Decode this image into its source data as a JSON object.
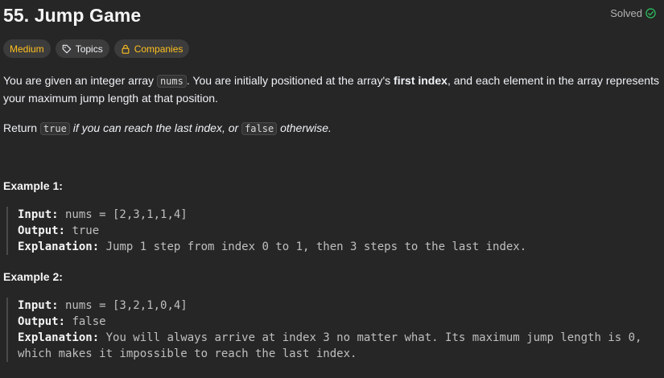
{
  "problem": {
    "title": "55. Jump Game",
    "status_label": "Solved"
  },
  "tags": {
    "difficulty": "Medium",
    "topics": "Topics",
    "companies": "Companies"
  },
  "description": {
    "p1_a": "You are given an integer array ",
    "p1_code": "nums",
    "p1_b": ". You are initially positioned at the array's ",
    "p1_bold": "first index",
    "p1_c": ", and each element in the array represents your maximum jump length at that position.",
    "p2_a": "Return ",
    "p2_code1": "true",
    "p2_b": " if you can reach the last index, or ",
    "p2_code2": "false",
    "p2_c": " otherwise."
  },
  "examples": [
    {
      "title": "Example 1:",
      "input_label": "Input:",
      "input_value": " nums = [2,3,1,1,4]",
      "output_label": "Output:",
      "output_value": " true",
      "explanation_label": "Explanation:",
      "explanation_value": " Jump 1 step from index 0 to 1, then 3 steps to the last index."
    },
    {
      "title": "Example 2:",
      "input_label": "Input:",
      "input_value": " nums = [3,2,1,0,4]",
      "output_label": "Output:",
      "output_value": " false",
      "explanation_label": "Explanation:",
      "explanation_value": " You will always arrive at index 3 no matter what. Its maximum jump length is 0, which makes it impossible to reach the last index."
    }
  ],
  "colors": {
    "background": "#262626",
    "difficulty_medium": "#ffc01e",
    "solved_check": "#2cbb5d"
  },
  "icons": {
    "solved": "check-circle-icon",
    "topics": "tag-icon",
    "companies": "lock-icon"
  }
}
